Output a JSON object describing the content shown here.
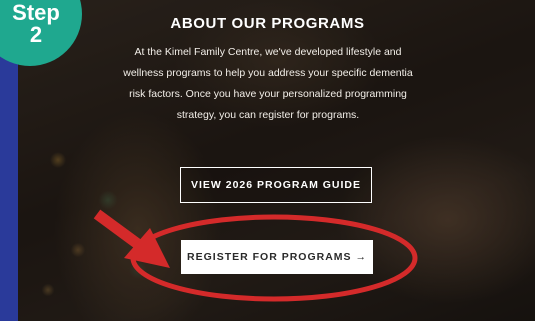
{
  "step_badge": {
    "word": "Step",
    "number": "2",
    "color": "#1fa88f"
  },
  "section": {
    "title": "ABOUT OUR PROGRAMS",
    "description": "At the Kimel Family Centre, we've developed lifestyle and wellness programs to help you address your specific dementia risk factors. Once you have your personalized programming strategy, you can register for programs."
  },
  "buttons": {
    "guide_label": "VIEW 2026 PROGRAM GUIDE",
    "register_label": "REGISTER FOR PROGRAMS →"
  },
  "annotation": {
    "color": "#d42a2a",
    "shapes": [
      "arrow",
      "ellipse"
    ]
  },
  "colors": {
    "page_border": "#2a3a9a",
    "button_bg": "#ffffff"
  }
}
